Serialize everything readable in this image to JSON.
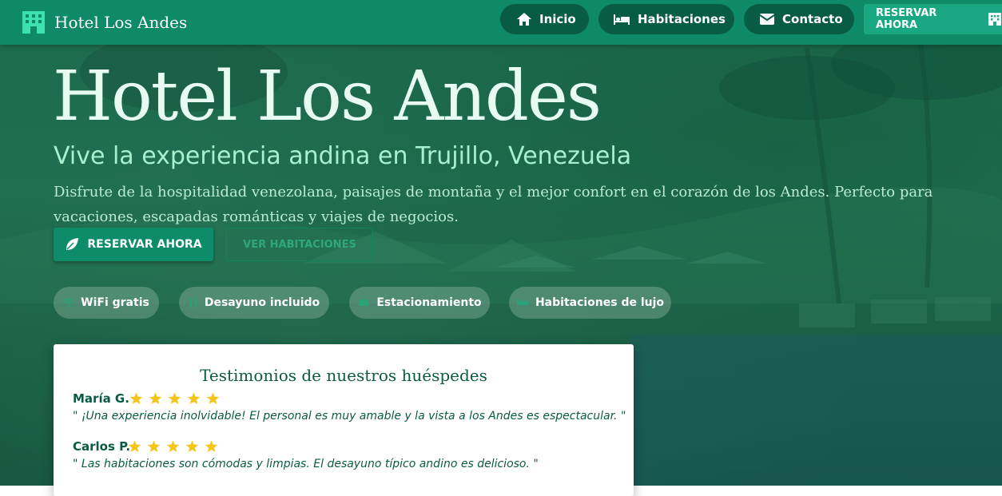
{
  "brand": {
    "name": "Hotel Los Andes",
    "icon": "hotel-icon"
  },
  "nav": {
    "items": [
      {
        "label": "Inicio",
        "icon": "home-icon"
      },
      {
        "label": "Habitaciones",
        "icon": "bed-icon"
      },
      {
        "label": "Contacto",
        "icon": "envelope-icon"
      }
    ],
    "reserve_label": "RESERVAR AHORA",
    "reserve_icon": "hotel-icon"
  },
  "hero": {
    "title": "Hotel Los Andes",
    "subtitle": "Vive la experiencia andina en Trujillo, Venezuela",
    "description": "Disfrute de la hospitalidad venezolana, paisajes de montaña y el mejor confort en el corazón de los Andes. Perfecto para vacaciones, escapadas románticas y viajes de negocios.",
    "primary_button": "RESERVAR AHORA",
    "secondary_button": "VER HABITACIONES"
  },
  "features": [
    {
      "label": "WiFi gratis",
      "icon": "wifi-icon"
    },
    {
      "label": "Desayuno incluido",
      "icon": "utensils-icon"
    },
    {
      "label": "Estacionamiento",
      "icon": "car-icon"
    },
    {
      "label": "Habitaciones de lujo",
      "icon": "bed-icon"
    }
  ],
  "testimonials": {
    "title": "Testimonios de nuestros huéspedes",
    "items": [
      {
        "name": "María G.",
        "rating": 5,
        "quote": "\" ¡Una experiencia inolvidable! El personal es muy amable y la vista a los Andes es espectacular. \""
      },
      {
        "name": "Carlos P.",
        "rating": 5,
        "quote": "\" Las habitaciones son cómodas y limpias. El desayuno típico andino es delicioso. \""
      }
    ]
  },
  "colors": {
    "navbar": "#0e8a68",
    "nav_pill": "#075c43",
    "accent": "#19a882",
    "star": "#f5c518",
    "text_dark_green": "#0b5a43"
  }
}
